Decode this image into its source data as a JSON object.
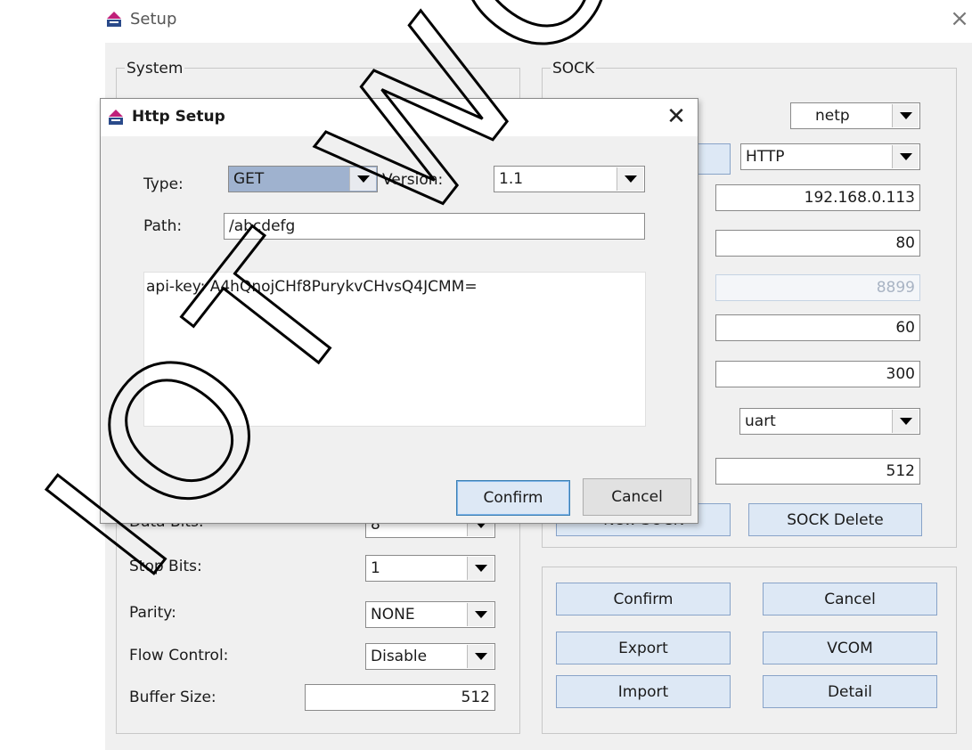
{
  "main_window": {
    "title": "Setup",
    "close_glyph": "×",
    "system": {
      "group_title": "System",
      "data_bits_label": "Data Bits:",
      "data_bits_value": "8",
      "stop_bits_label": "Stop Bits:",
      "stop_bits_value": "1",
      "parity_label": "Parity:",
      "parity_value": "NONE",
      "flow_control_label": "Flow Control:",
      "flow_control_value": "Disable",
      "buffer_size_label": "Buffer Size:",
      "buffer_size_value": "512"
    },
    "sock": {
      "group_title": "SOCK",
      "name_value": "netp",
      "protocol_value": "HTTP",
      "server_value": "192.168.0.113",
      "server_port_value": "80",
      "local_port_value": "8899",
      "timeout_value": "60",
      "tcp_timeout_value": "300",
      "route_value": "uart",
      "buffer_value": "512",
      "new_sock_label": "New SOCK",
      "sock_delete_label": "SOCK Delete"
    },
    "actions": {
      "confirm": "Confirm",
      "cancel": "Cancel",
      "export": "Export",
      "vcom": "VCOM",
      "import": "Import",
      "detail": "Detail"
    }
  },
  "http_dialog": {
    "title": "Http Setup",
    "close_glyph": "✕",
    "type_label": "Type:",
    "type_value": "GET",
    "version_label": "Version:",
    "version_value": "1.1",
    "path_label": "Path:",
    "path_value": "/abcdefg",
    "headers_text": "api-key: A4hQnojCHf8PurykvCHvsQ4JCMM=",
    "confirm_label": "Confirm",
    "cancel_label": "Cancel"
  },
  "watermark": {
    "text": "IOT WORLD"
  }
}
